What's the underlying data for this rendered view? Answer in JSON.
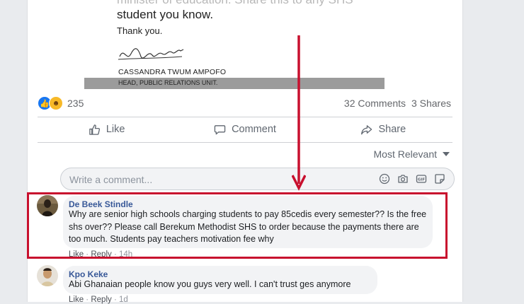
{
  "letter": {
    "line1": "minister of education. Share this to any SHS",
    "line2": "student you know.",
    "line3": "Thank you.",
    "name": "CASSANDRA TWUM AMPOFO",
    "title": "HEAD, PUBLIC RELATIONS UNIT."
  },
  "post": {
    "reaction_count": "235",
    "comments_count": "32 Comments",
    "shares_count": "3 Shares"
  },
  "actions": {
    "like": "Like",
    "comment": "Comment",
    "share": "Share"
  },
  "sort": {
    "label": "Most Relevant"
  },
  "composer": {
    "placeholder": "Write a comment..."
  },
  "comments": [
    {
      "author": "De Beek Stindle",
      "text": "Why are senior high schools charging students to pay 85cedis every semester?? Is the free shs over?? Please call Berekum Methodist SHS to order because the payments there are too much. Students pay teachers motivation fee why",
      "like": "Like",
      "reply": "Reply",
      "time": "14h"
    },
    {
      "author": "Kpo Keke",
      "text": "Abi Ghanaian people know you guys very well. I can't trust ges anymore",
      "like": "Like",
      "reply": "Reply",
      "time": "1d"
    }
  ],
  "colors": {
    "highlight": "#c8102e",
    "link": "#385898",
    "facebook_blue": "#1877f2"
  }
}
